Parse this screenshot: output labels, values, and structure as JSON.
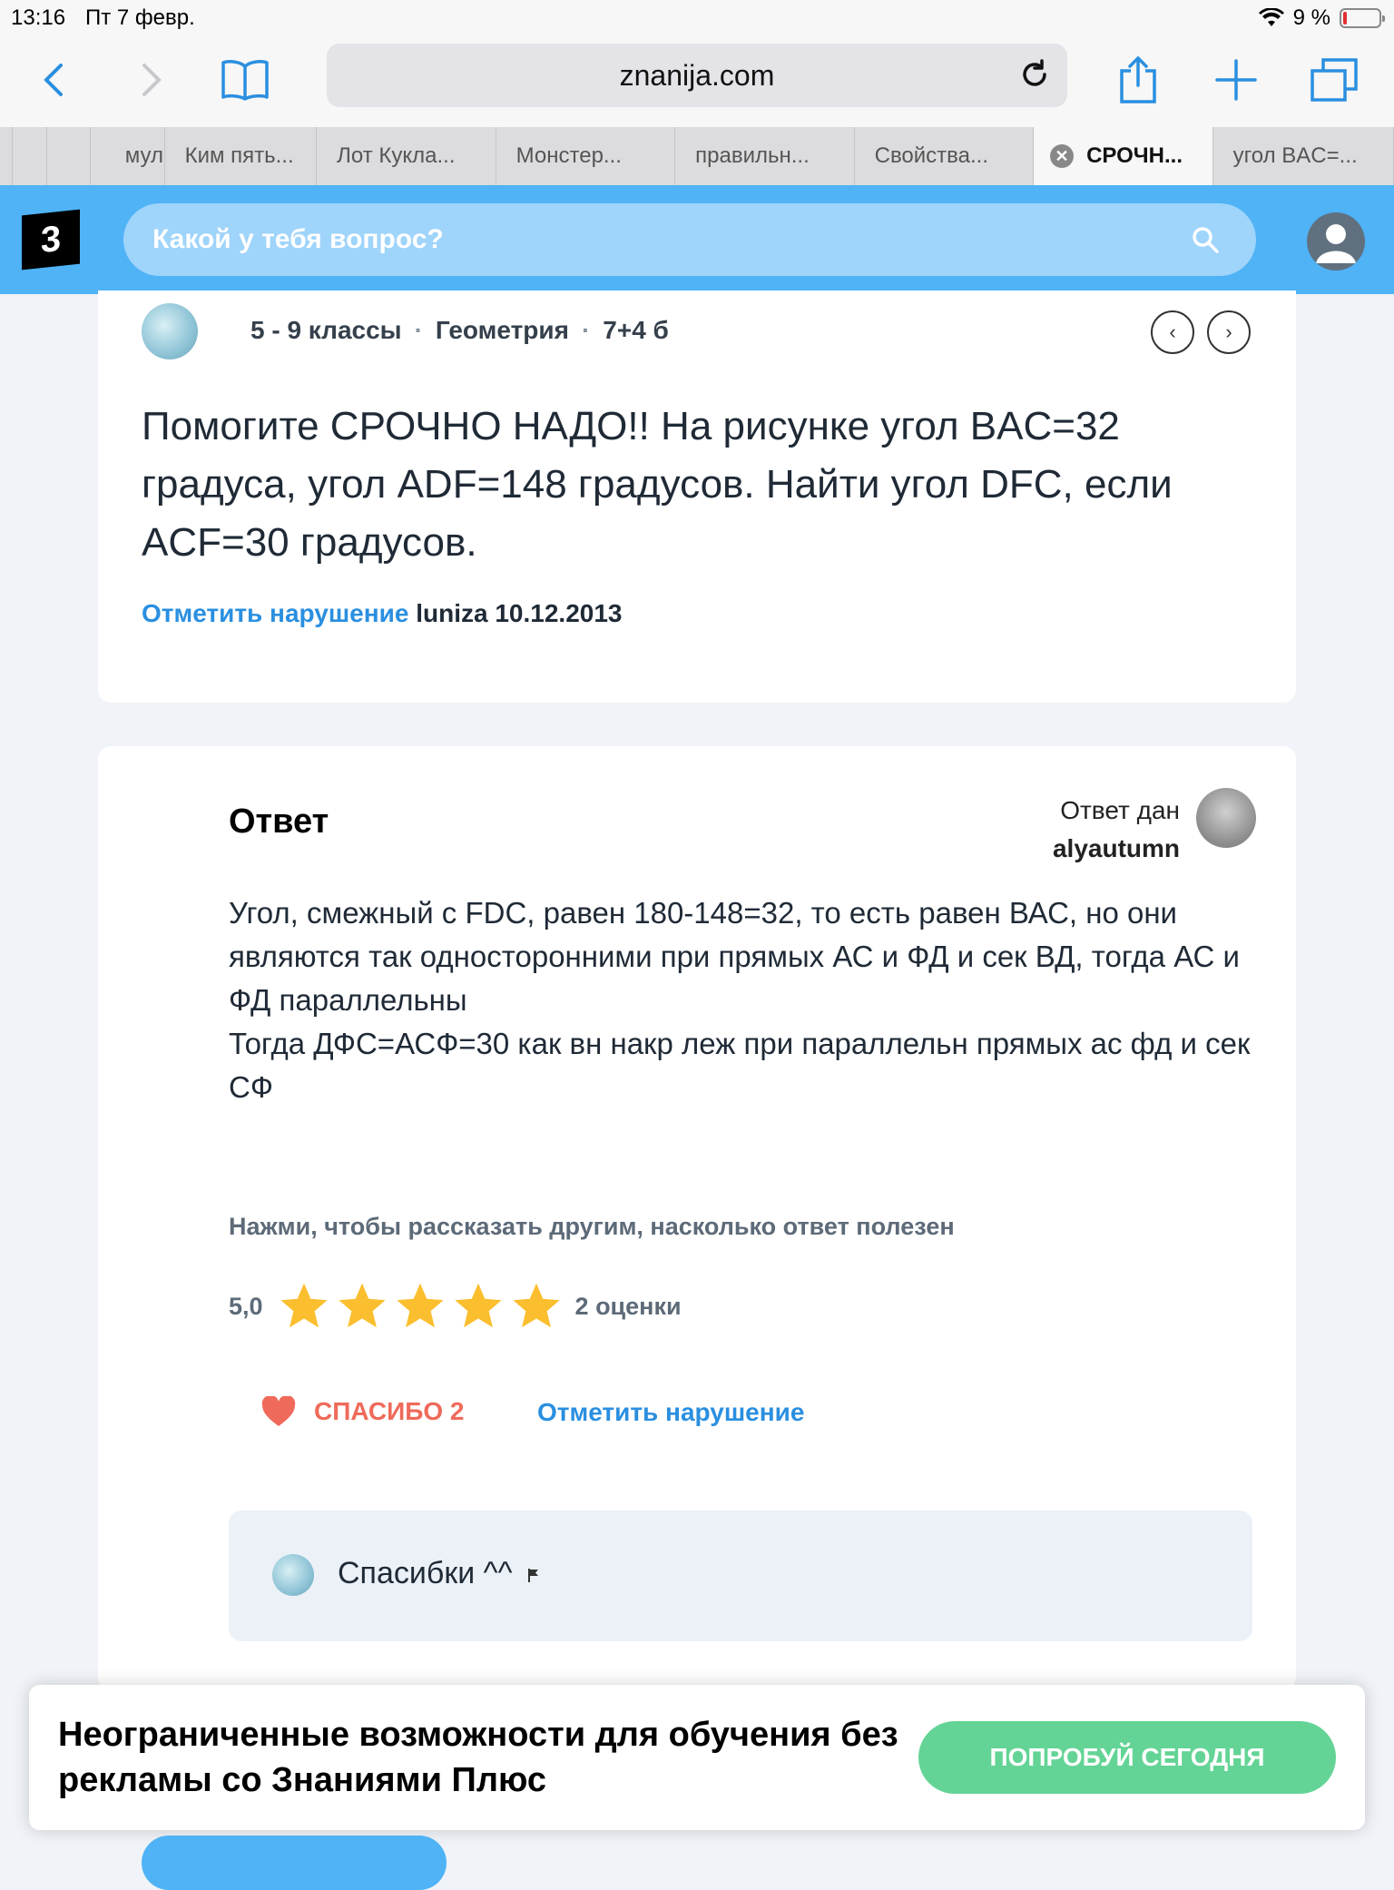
{
  "status_bar": {
    "time": "13:16",
    "date": "Пт 7 февр.",
    "battery": "9 %"
  },
  "browser": {
    "url": "znanija.com",
    "tabs": [
      "мул",
      "Ким пять...",
      "Лот Кукла...",
      "Монстер...",
      "правильн...",
      "Свойства...",
      "СРОЧН...",
      "угол BAC=..."
    ],
    "active_tab_index": 6
  },
  "site": {
    "search_placeholder": "Какой у тебя вопрос?",
    "logo_text": "3",
    "accent_color": "#4fb3f6"
  },
  "question": {
    "grade": "5 - 9 классы",
    "subject": "Геометрия",
    "points": "7+4 б",
    "text": "Помогите СРОЧНО НАДО!! На рисунке угол BAC=32 градуса, угол ADF=148 градусов. Найти угол DFC, если ACF=30 градусов.",
    "report_label": "Отметить нарушение",
    "author": "luniza",
    "date": "10.12.2013"
  },
  "answer": {
    "title": "Ответ",
    "answered_by_label": "Ответ дан",
    "author": "alyautumn",
    "text": "Угол, смежный с FDC, равен 180-148=32, то есть равен ВАС, но они являются так односторонними при прямых АС и ФД и сек ВД, тогда АС и ФД параллельны\nТогда ДФС=АСФ=30 как вн накр леж при параллельн прямых ас фд и сек СФ",
    "rate_prompt": "Нажми, чтобы рассказать другим, насколько ответ полезен",
    "rating_value": "5,0",
    "stars_filled": 5,
    "ratings_count": "2 оценки",
    "thanks_label": "СПАСИБО 2",
    "report_label": "Отметить нарушение",
    "comment": "Спасибки ^^"
  },
  "promo": {
    "text": "Неограниченные возможности для обучения без рекламы со Знаниями Плюс",
    "button": "ПОПРОБУЙ СЕГОДНЯ",
    "button_color": "#63d495"
  }
}
